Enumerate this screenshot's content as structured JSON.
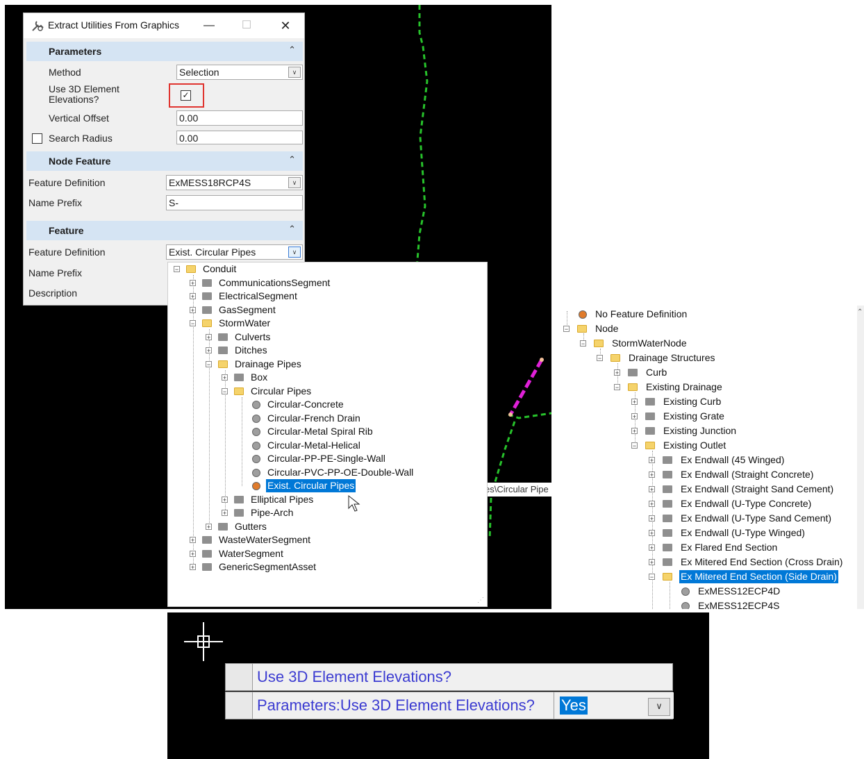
{
  "dialog": {
    "title": "Extract Utilities From Graphics",
    "titlebar_icon": "utility-wrench-icon",
    "parameters": {
      "section_title": "Parameters",
      "method_label": "Method",
      "method_value": "Selection",
      "use3d_label_line1": "Use 3D Element",
      "use3d_label_line2": "Elevations?",
      "use3d_checked": true,
      "vertical_offset_label": "Vertical Offset",
      "vertical_offset_value": "0.00",
      "search_radius_label": "Search Radius",
      "search_radius_value": "0.00"
    },
    "node_feature": {
      "section_title": "Node Feature",
      "feature_definition_label": "Feature Definition",
      "feature_definition_value": "ExMESS18RCP4S",
      "name_prefix_label": "Name Prefix",
      "name_prefix_value": "S-"
    },
    "feature": {
      "section_title": "Feature",
      "feature_definition_label": "Feature Definition",
      "feature_definition_value": "Exist. Circular Pipes",
      "name_prefix_label": "Name Prefix",
      "description_label": "Description"
    }
  },
  "tree1": [
    "Conduit",
    "CommunicationsSegment",
    "ElectricalSegment",
    "GasSegment",
    "StormWater",
    "Culverts",
    "Ditches",
    "Drainage Pipes",
    "Box",
    "Circular Pipes",
    "Circular-Concrete",
    "Circular-French Drain",
    "Circular-Metal Spiral Rib",
    "Circular-Metal-Helical",
    "Circular-PP-PE-Single-Wall",
    "Circular-PVC-PP-OE-Double-Wall",
    "Exist. Circular Pipes",
    "Elliptical Pipes",
    "Pipe-Arch",
    "Gutters",
    "WasteWaterSegment",
    "WaterSegment",
    "GenericSegmentAsset"
  ],
  "canvas": {
    "tooltip_text": "es\\Circular Pipe"
  },
  "tree2": [
    "No Feature Definition",
    "Node",
    "StormWaterNode",
    "Drainage Structures",
    "Curb",
    "Existing Drainage",
    "Existing Curb",
    "Existing Grate",
    "Existing Junction",
    "Existing Outlet",
    "Ex Endwall (45 Winged)",
    "Ex Endwall (Straight Concrete)",
    "Ex Endwall (Straight Sand Cement)",
    "Ex Endwall (U-Type Concrete)",
    "Ex Endwall (U-Type Sand Cement)",
    "Ex Endwall (U-Type Winged)",
    "Ex Flared End Section",
    "Ex Mitered End Section (Cross Drain)",
    "Ex Mitered End Section (Side Drain)",
    "ExMESS12ECP4D",
    "ExMESS12ECP4S"
  ],
  "bottom": {
    "row1": "Use 3D Element Elevations?",
    "row2": "Parameters:Use 3D Element Elevations?",
    "value": "Yes"
  }
}
